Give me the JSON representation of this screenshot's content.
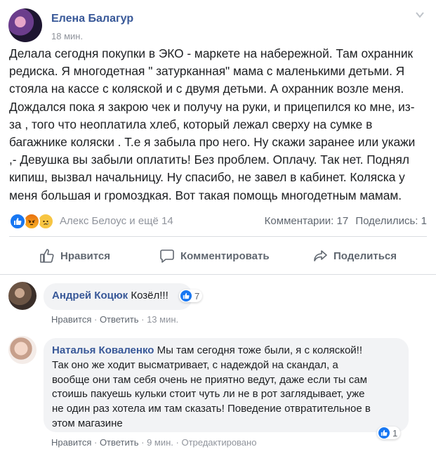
{
  "post": {
    "author": "Елена Балагур",
    "time": "18 мин.",
    "text": "Делала сегодня покупки в ЭКО - маркете на набережной. Там охранник\nредиска. Я многодетная \" затурканная\" мама с маленькими детьми. Я\nстояла на кассе с коляской и с двумя детьми. А охранник возле меня.\nДождался пока я закрою чек и получу на руки, и прицепился ко мне, из-\nза , того что неоплатила хлеб, который лежал сверху на сумке в\nбагажнике коляски . Т.е я забыла про него. Ну скажи заранее или укажи\n,- Девушка вы забыли оплатить! Без проблем. Оплачу. Так нет. Поднял\nкипиш, вызвал начальницу. Ну спасибо, не завел в кабинет. Коляска у\nменя большая и громоздкая. Вот такая помощь многодетным мамам.",
    "reactors": "Алекс Белоус и ещё 14",
    "comments_count": "Комментарии: 17",
    "shares_count": "Поделились: 1",
    "reactions": [
      "like",
      "angry",
      "sad"
    ]
  },
  "actions": {
    "like": "Нравится",
    "comment": "Комментировать",
    "share": "Поделиться"
  },
  "comments": [
    {
      "author": "Андрей Коцюк",
      "text": "Козёл!!!",
      "likes": "7",
      "like_label": "Нравится",
      "reply_label": "Ответить",
      "time": "13 мин.",
      "edited": ""
    },
    {
      "author": "Наталья Коваленко",
      "text": "Мы там сегодня тоже были, я с коляской!!\nТак оно же ходит высматривает, с надеждой на скандал, а\nвообще они там себя очень не приятно ведут, даже если ты сам\nстоишь пакуешь кульки стоит чуть ли не в рот заглядывает, уже\nне один раз хотела им там сказать! Поведение отвратительное в\nэтом магазине",
      "likes": "1",
      "like_label": "Нравится",
      "reply_label": "Ответить",
      "time": "9 мин.",
      "edited": "Отредактировано"
    }
  ],
  "colors": {
    "link": "#385898",
    "meta": "#90949c",
    "bubble": "#f2f3f5",
    "like_blue": "#1877f2"
  }
}
